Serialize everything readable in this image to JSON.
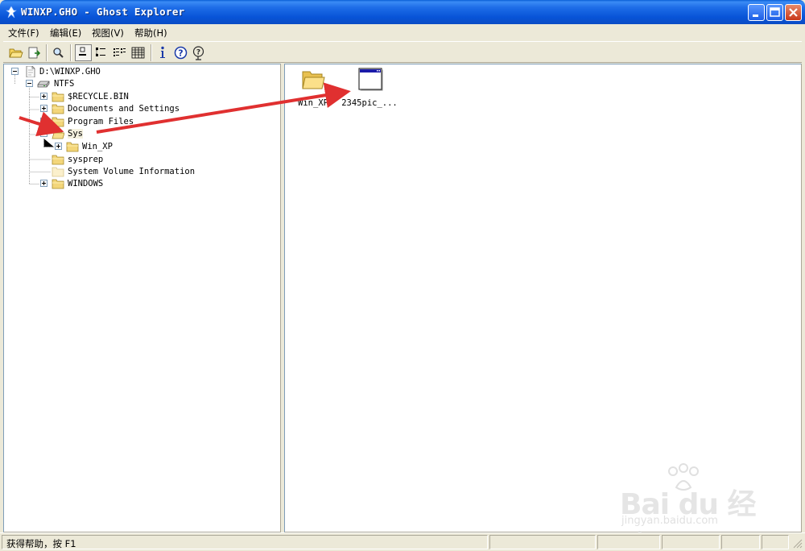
{
  "window": {
    "title": "WINXP.GHO - Ghost Explorer",
    "title_bar_color": "#0a54d8",
    "close_color": "#c8381a"
  },
  "menu": {
    "items": [
      {
        "label": "文件(F)"
      },
      {
        "label": "编辑(E)"
      },
      {
        "label": "视图(V)"
      },
      {
        "label": "帮助(H)"
      }
    ]
  },
  "toolbar": {
    "buttons": [
      "open-folder-icon",
      "extract-icon",
      "find-icon",
      "large-icons-view-icon",
      "small-icons-view-icon",
      "list-view-icon",
      "details-view-icon",
      "properties-icon",
      "help-icon",
      "context-help-icon"
    ]
  },
  "tree": {
    "root": "D:\\WINXP.GHO",
    "partition": "NTFS",
    "folders": [
      {
        "label": "$RECYCLE.BIN",
        "expandable": true
      },
      {
        "label": "Documents and Settings",
        "expandable": true
      },
      {
        "label": "Program Files",
        "expandable": true
      },
      {
        "label": "Sys",
        "expandable": true,
        "expanded": true,
        "selected": true
      },
      {
        "label": "Win_XP",
        "expandable": true,
        "child": true
      },
      {
        "label": "sysprep",
        "expandable": false
      },
      {
        "label": "System Volume Information",
        "expandable": false
      },
      {
        "label": "WINDOWS",
        "expandable": true
      }
    ]
  },
  "list": {
    "items": [
      {
        "label": "Win_XP",
        "icon": "folder-icon"
      },
      {
        "label": "2345pic_...",
        "icon": "application-window-icon"
      }
    ]
  },
  "annotation": {
    "arrow_color": "#e03030"
  },
  "status": {
    "text": "获得帮助，按 F1"
  },
  "watermark": {
    "brand": "Bai du 经验",
    "url": "jingyan.baidu.com"
  }
}
